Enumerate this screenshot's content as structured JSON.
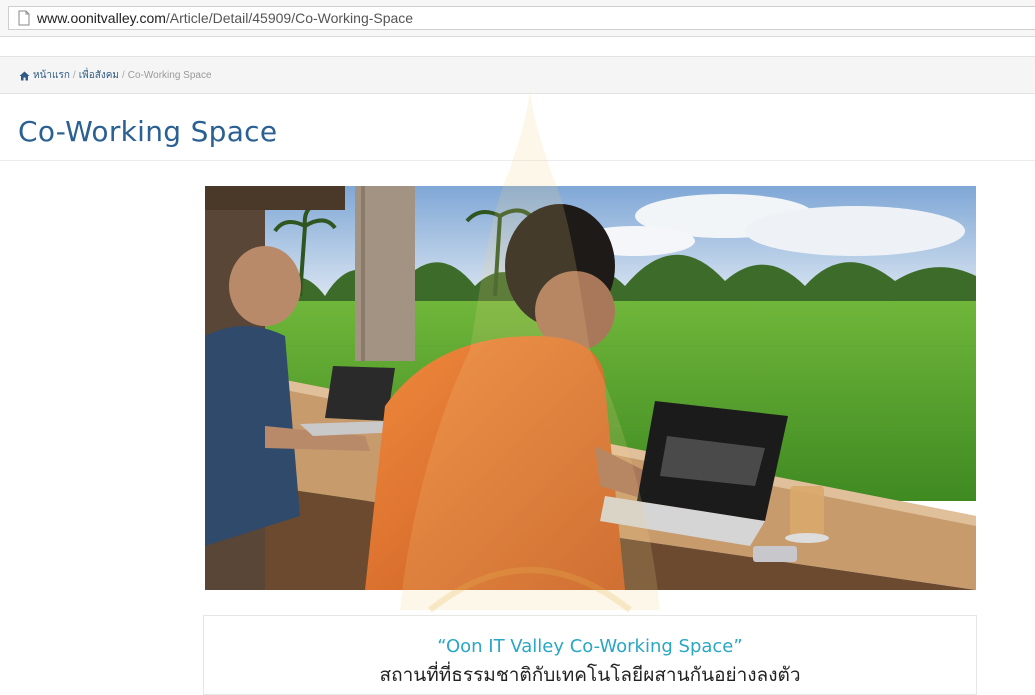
{
  "browser": {
    "url_domain": "www.oonitvalley.com",
    "url_path": "/Article/Detail/45909/Co-Working-Space"
  },
  "breadcrumb": {
    "home": "หน้าแรก",
    "category": "เพื่อสังคม",
    "current": "Co-Working Space",
    "separator": "/"
  },
  "article": {
    "title": "Co-Working Space",
    "caption_title": "“Oon IT Valley Co-Working Space”",
    "caption_subtitle": "สถานที่ที่ธรรมชาติกับเทคโนโลยีผสานกันอย่างลงตัว"
  },
  "colors": {
    "title": "#2b6093",
    "caption_accent": "#2aa6c6",
    "breadcrumb_link": "#2f5c86"
  },
  "icons": [
    "page-icon",
    "home-icon"
  ]
}
